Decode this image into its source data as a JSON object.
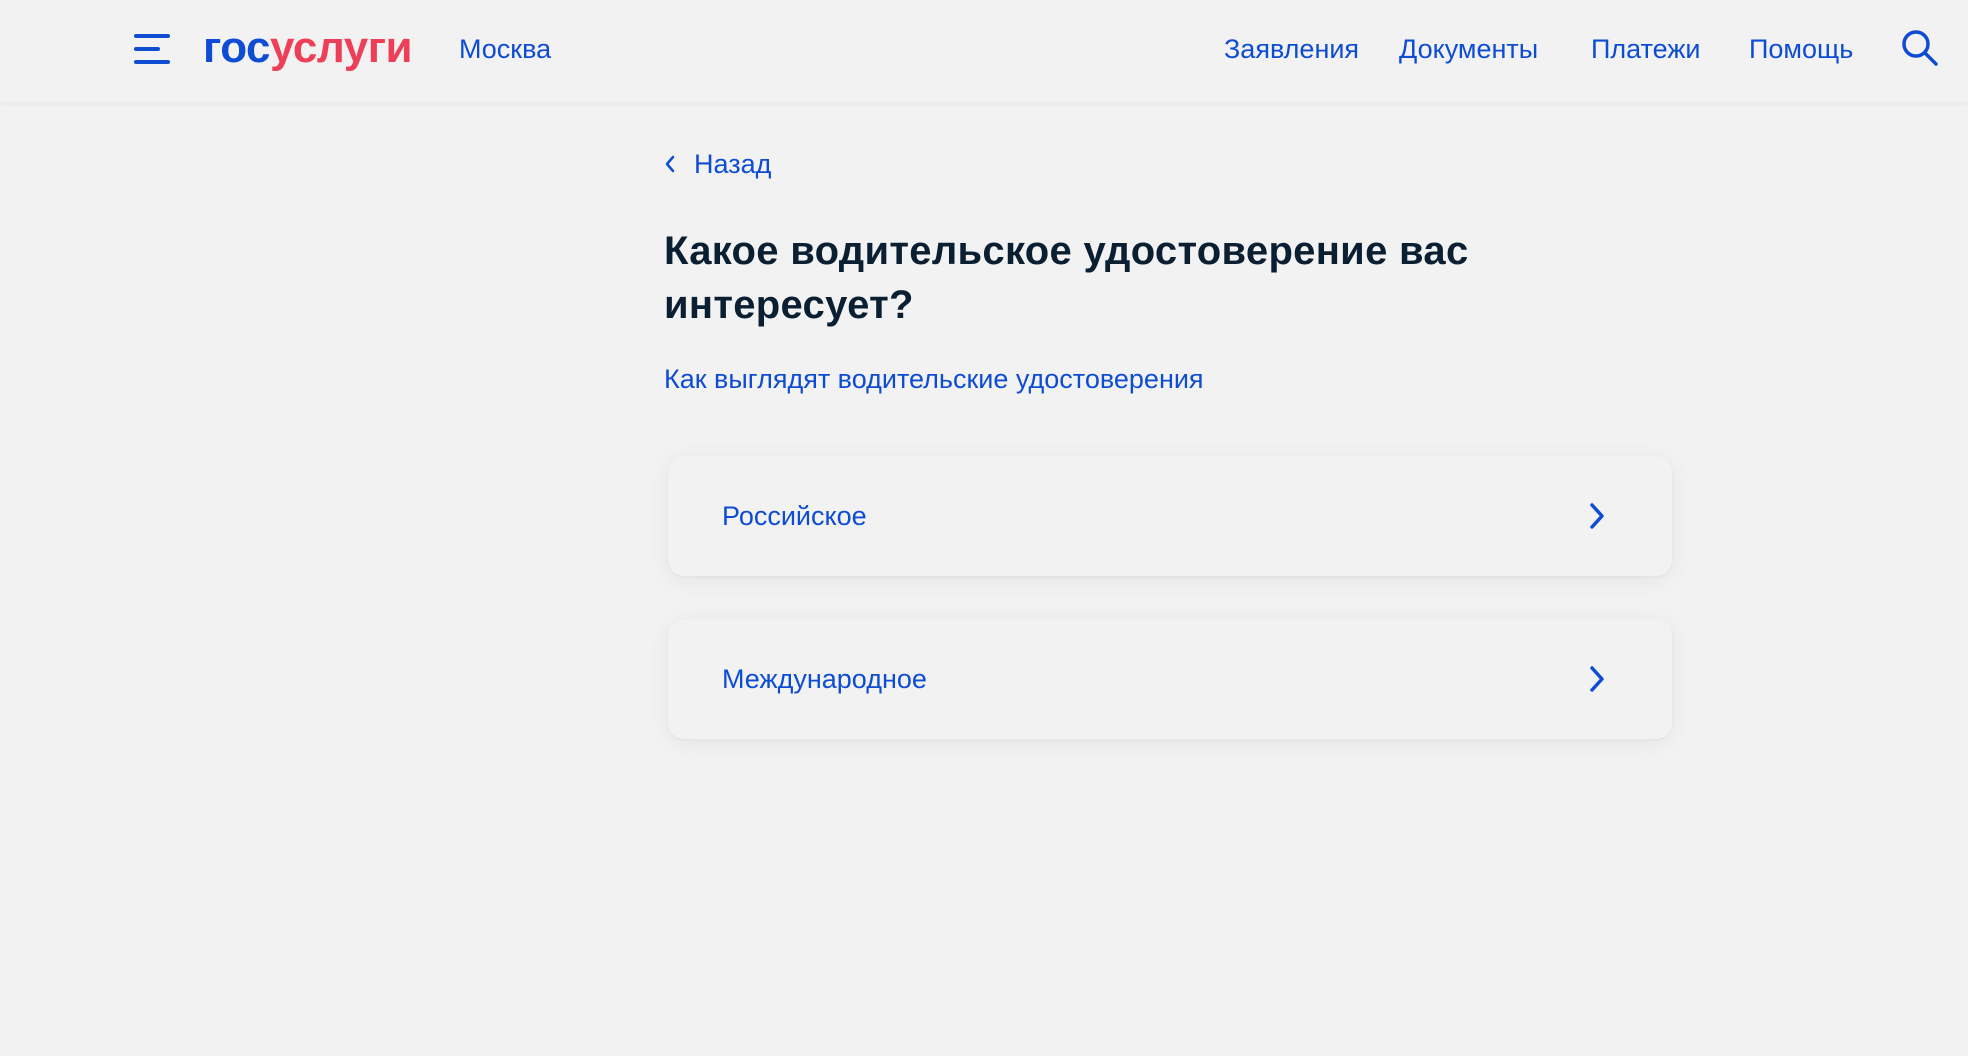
{
  "header": {
    "logo_part1": "гос",
    "logo_part2": "услуги",
    "city": "Москва",
    "nav": [
      "Заявления",
      "Документы",
      "Платежи",
      "Помощь"
    ],
    "menu_icon": "hamburger-menu-icon",
    "search_icon": "search-icon"
  },
  "back": {
    "label": "Назад",
    "icon": "chevron-left-icon"
  },
  "page": {
    "title": "Какое водительское удостоверение вас интересует?",
    "info_link": "Как выглядят водительские удостоверения"
  },
  "options": [
    {
      "label": "Российское",
      "icon": "chevron-right-icon"
    },
    {
      "label": "Международное",
      "icon": "chevron-right-icon"
    }
  ],
  "colors": {
    "accent": "#0d4cd3",
    "logo_red": "#ee3f58",
    "text_dark": "#0b1f33",
    "background": "#f2f2f2"
  }
}
